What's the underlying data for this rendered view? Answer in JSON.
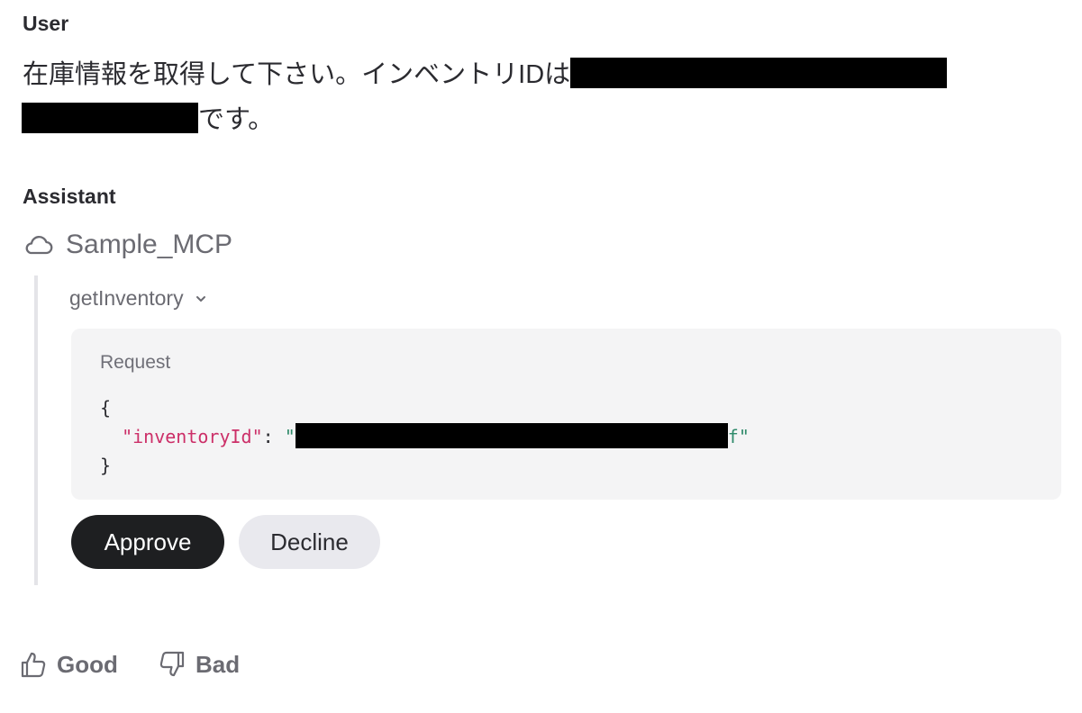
{
  "user": {
    "label": "User",
    "message_part1": "在庫情報を取得して下さい。インベントリIDは",
    "message_part2": "です。"
  },
  "assistant": {
    "label": "Assistant",
    "tool": {
      "icon": "cloud-icon",
      "server_name": "Sample_MCP",
      "function_name": "getInventory",
      "request_label": "Request",
      "request_json": {
        "open_brace": "{",
        "key": "\"inventoryId\"",
        "colon": ": ",
        "value_open": "\"",
        "value_close_tail": "f\"",
        "close_brace": "}"
      }
    },
    "buttons": {
      "approve": "Approve",
      "decline": "Decline"
    }
  },
  "feedback": {
    "good_label": "Good",
    "bad_label": "Bad"
  },
  "colors": {
    "approve_bg": "#1e1f21",
    "decline_bg": "#e9e9ee",
    "json_key": "#cc2f68",
    "json_string": "#2e8a6a"
  }
}
